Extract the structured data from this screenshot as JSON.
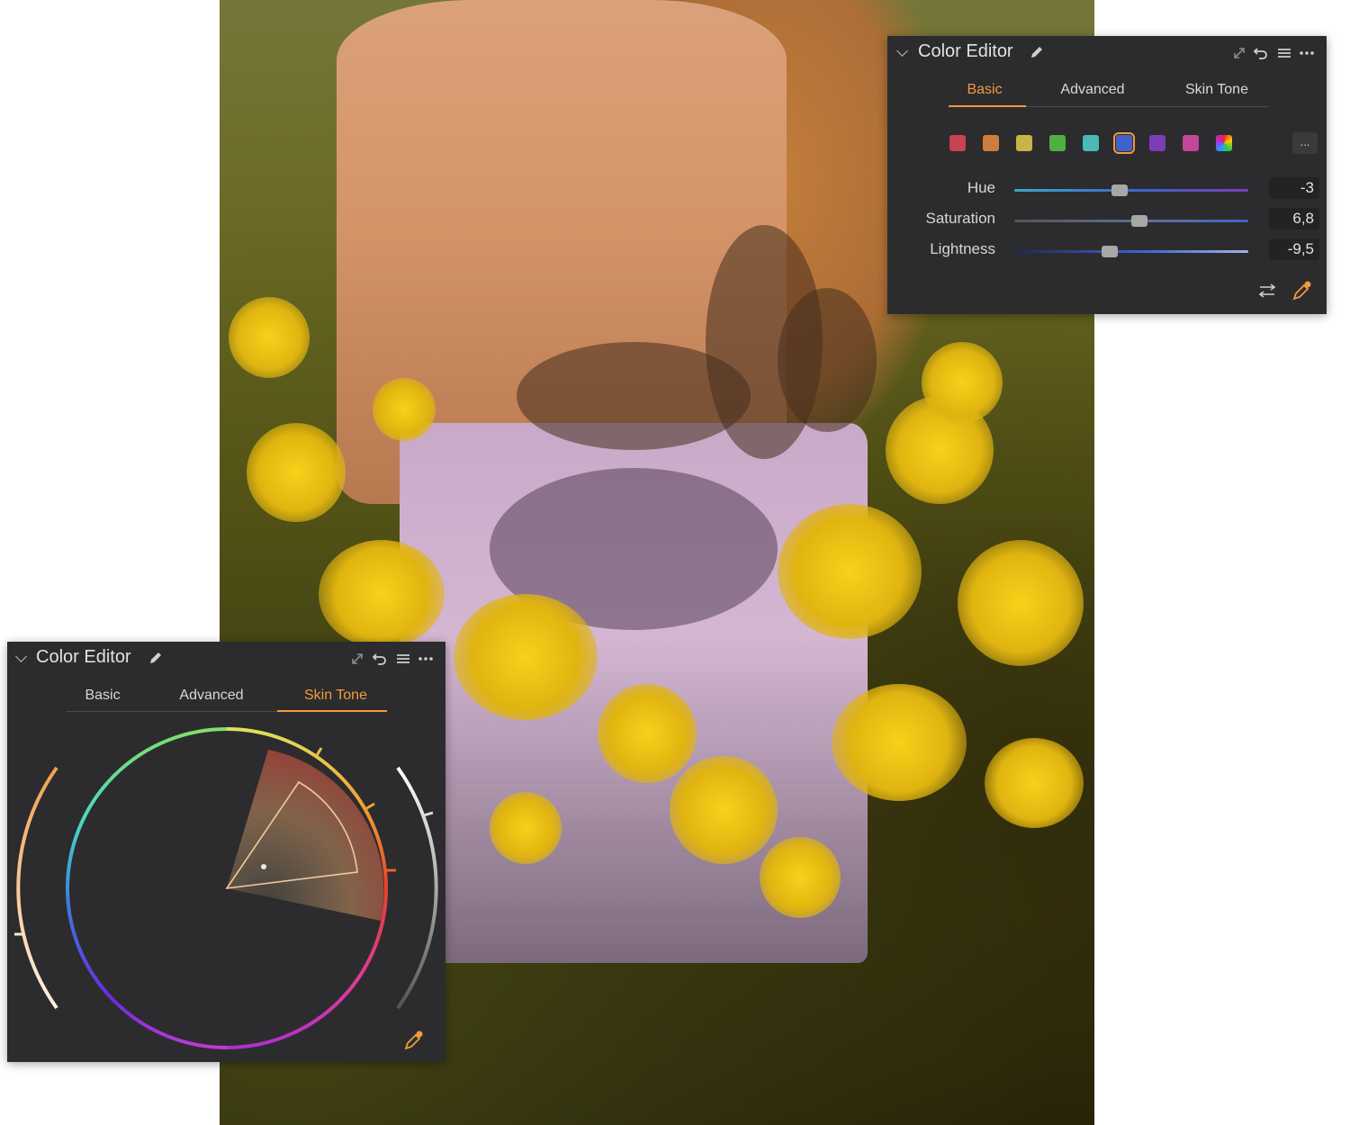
{
  "photo": {
    "description_label": ""
  },
  "panel_top": {
    "title": "Color Editor",
    "tabs": [
      {
        "label": "Basic",
        "active": true
      },
      {
        "label": "Advanced",
        "active": false
      },
      {
        "label": "Skin Tone",
        "active": false
      }
    ],
    "swatches": [
      {
        "name": "red",
        "color": "#c8424f"
      },
      {
        "name": "orange",
        "color": "#cf7d3c"
      },
      {
        "name": "yellow",
        "color": "#c9b447"
      },
      {
        "name": "green",
        "color": "#4eb043"
      },
      {
        "name": "cyan",
        "color": "#4bb9b6"
      },
      {
        "name": "blue",
        "color": "#3f63c8",
        "selected": true
      },
      {
        "name": "purple",
        "color": "#7b3db8"
      },
      {
        "name": "magenta",
        "color": "#c2469a"
      },
      {
        "name": "multi",
        "color": "multicolor"
      }
    ],
    "more_label": "...",
    "sliders": [
      {
        "label": "Hue",
        "value": "-3"
      },
      {
        "label": "Saturation",
        "value": "6,8"
      },
      {
        "label": "Lightness",
        "value": "-9,5"
      }
    ]
  },
  "panel_bottom": {
    "title": "Color Editor",
    "tabs": [
      {
        "label": "Basic",
        "active": false
      },
      {
        "label": "Advanced",
        "active": false
      },
      {
        "label": "Skin Tone",
        "active": true
      }
    ]
  },
  "colors": {
    "accent": "#f39a3d",
    "panel_bg": "#2c2c2e"
  }
}
